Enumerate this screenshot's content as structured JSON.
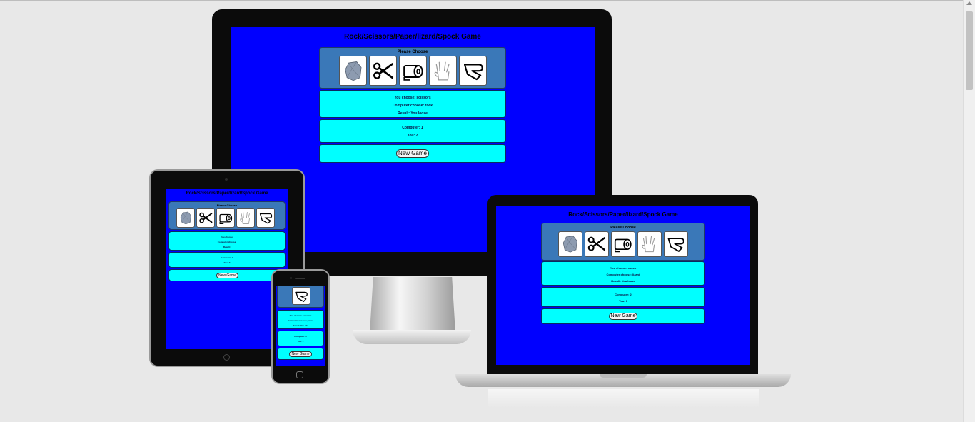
{
  "game": {
    "title": "Rock/Scissors/Paper/lizard/Spock Game",
    "please_choose": "Please Choose",
    "new_game_label": "New Game",
    "choices": [
      {
        "id": "rock",
        "icon": "rock-icon"
      },
      {
        "id": "scissors",
        "icon": "scissors-icon"
      },
      {
        "id": "paper",
        "icon": "paper-roll-icon"
      },
      {
        "id": "spock",
        "icon": "spock-hand-icon"
      },
      {
        "id": "lizard",
        "icon": "lizard-hand-icon"
      }
    ]
  },
  "monitor": {
    "you_chose": "You choose: scissors",
    "computer_chose": "Computer choose: rock",
    "result": "Result: You loose",
    "computer_score": "Computer: 1",
    "you_score": "You: 2"
  },
  "tablet": {
    "you_chose": "You choose:",
    "computer_chose": "Computer choose:",
    "result": "Result:",
    "computer_score": "Computer: 0",
    "you_score": "You: 0"
  },
  "laptop": {
    "you_chose": "You choose: spock",
    "computer_chose": "Computer choose: lizard",
    "result": "Result: You loose",
    "computer_score": "Computer: 2",
    "you_score": "You: 0"
  },
  "phone": {
    "you_chose": "You choose: scissors",
    "computer_chose": "Computer choose: paper",
    "result": "Result: You win",
    "computer_score": "Computer: 1",
    "you_score": "You: 2"
  },
  "colors": {
    "page_bg": "#e8e8e8",
    "screen_bg": "#0000ff",
    "choose_panel": "#3a78b8",
    "result_panel": "#00ffff"
  }
}
